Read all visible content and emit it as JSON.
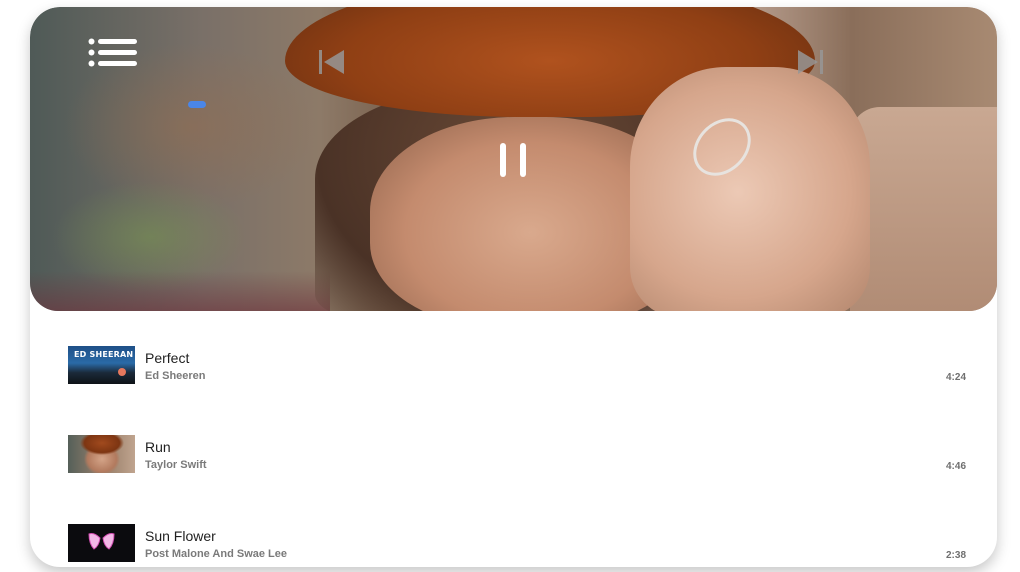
{
  "player": {
    "colors": {
      "progress": "#4a86e8",
      "controls": "#ffffff"
    },
    "icons": {
      "menu": "list-menu-icon",
      "prev": "skip-previous-icon",
      "next": "skip-next-icon",
      "pause": "pause-icon"
    }
  },
  "playlist": {
    "tracks": [
      {
        "title": "Perfect",
        "artist": "Ed Sheeren",
        "duration": "4:24",
        "cover_text": "ED SHEERAN"
      },
      {
        "title": "Run",
        "artist": "Taylor Swift",
        "duration": "4:46"
      },
      {
        "title": "Sun Flower",
        "artist": "Post Malone And Swae Lee",
        "duration": "2:38"
      }
    ]
  }
}
